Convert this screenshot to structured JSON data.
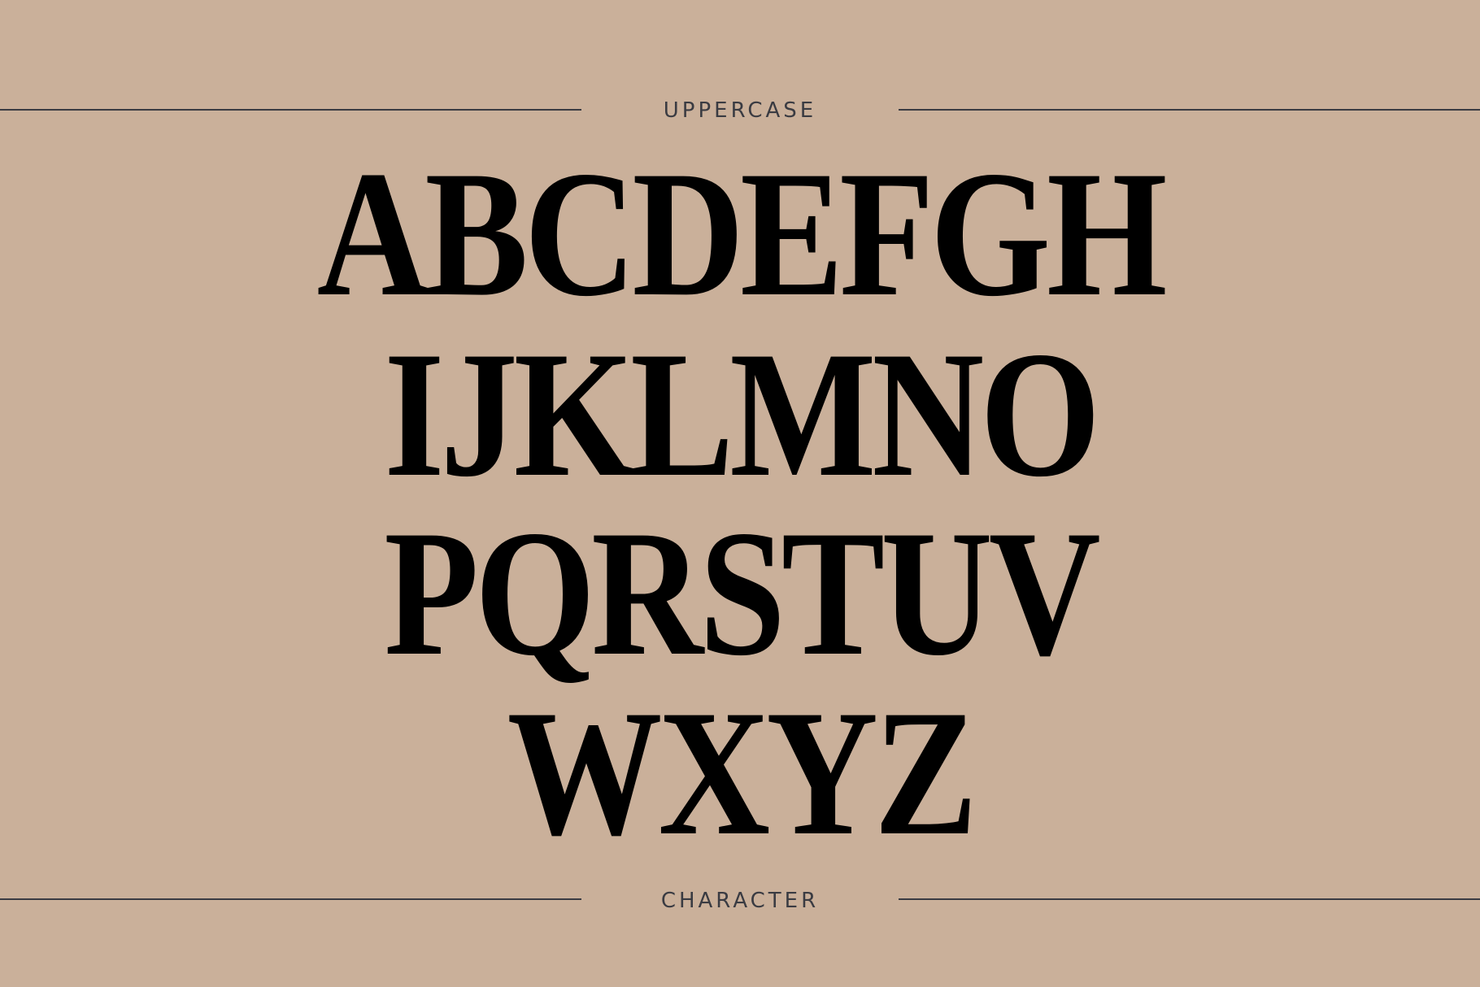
{
  "header_label": "UPPERCASE",
  "footer_label": "CHARACTER",
  "rows": [
    "ABCDEFGH",
    "IJKLMNO",
    "PQRSTUV",
    "WXYZ"
  ],
  "colors": {
    "background": "#cab09a",
    "rule": "#3a3b42",
    "glyph": "#000000"
  }
}
